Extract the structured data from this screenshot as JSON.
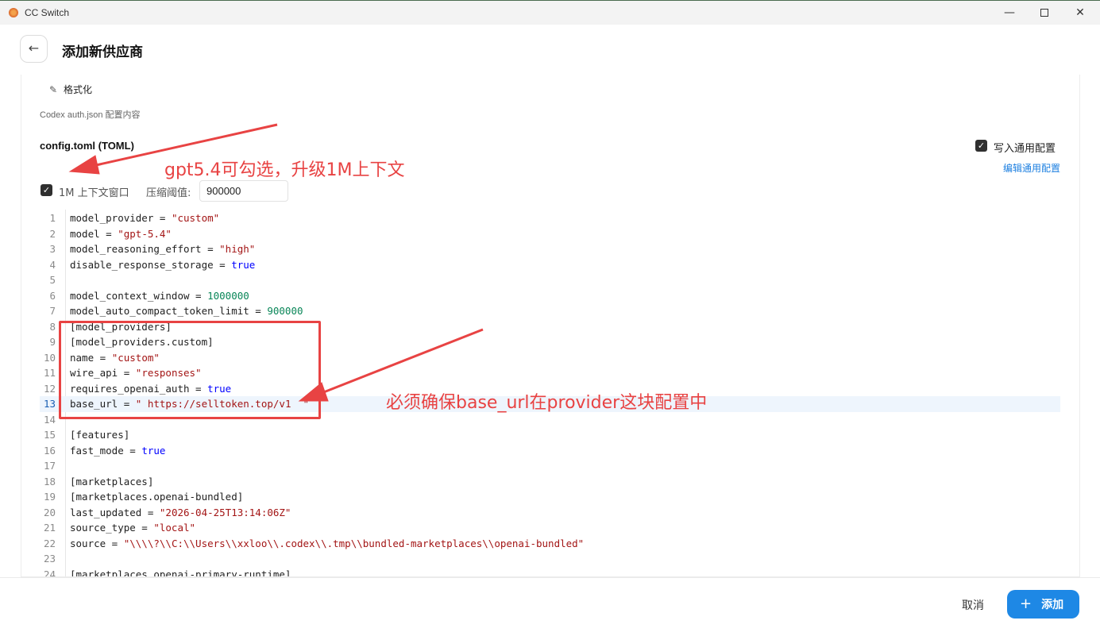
{
  "window": {
    "title": "CC Switch",
    "minimize": "—",
    "close": "✕"
  },
  "header": {
    "back_icon": "←",
    "title": "添加新供应商"
  },
  "toolbar": {
    "format_icon": "✎",
    "format_label": "格式化"
  },
  "auth": {
    "label": "Codex auth.json 配置内容"
  },
  "config": {
    "title": "config.toml (TOML)",
    "write_common_label": "写入通用配置",
    "write_common_checked": true,
    "edit_common_link": "编辑通用配置",
    "context_1m_label": "1M 上下文窗口",
    "context_1m_checked": true,
    "threshold_label": "压缩阈值:",
    "threshold_value": "900000"
  },
  "editor": {
    "active_line": 13,
    "lines": [
      {
        "n": "1",
        "text": "model_provider = \"custom\""
      },
      {
        "n": "2",
        "text": "model = \"gpt-5.4\""
      },
      {
        "n": "3",
        "text": "model_reasoning_effort = \"high\""
      },
      {
        "n": "4",
        "text": "disable_response_storage = true"
      },
      {
        "n": "5",
        "text": ""
      },
      {
        "n": "6",
        "text": "model_context_window = 1000000"
      },
      {
        "n": "7",
        "text": "model_auto_compact_token_limit = 900000"
      },
      {
        "n": "8",
        "text": "[model_providers]"
      },
      {
        "n": "9",
        "text": "[model_providers.custom]"
      },
      {
        "n": "10",
        "text": "name = \"custom\""
      },
      {
        "n": "11",
        "text": "wire_api = \"responses\""
      },
      {
        "n": "12",
        "text": "requires_openai_auth = true"
      },
      {
        "n": "13",
        "text": "base_url = \" https://selltoken.top/v1  \""
      },
      {
        "n": "14",
        "text": ""
      },
      {
        "n": "15",
        "text": "[features]"
      },
      {
        "n": "16",
        "text": "fast_mode = true"
      },
      {
        "n": "17",
        "text": ""
      },
      {
        "n": "18",
        "text": "[marketplaces]"
      },
      {
        "n": "19",
        "text": "[marketplaces.openai-bundled]"
      },
      {
        "n": "20",
        "text": "last_updated = \"2026-04-25T13:14:06Z\""
      },
      {
        "n": "21",
        "text": "source_type = \"local\""
      },
      {
        "n": "22",
        "text": "source = \"\\\\\\\\?\\\\C:\\\\Users\\\\xxloo\\\\.codex\\\\.tmp\\\\bundled-marketplaces\\\\openai-bundled\""
      },
      {
        "n": "23",
        "text": ""
      },
      {
        "n": "24",
        "text": "[marketplaces.openai-primary-runtime]"
      }
    ]
  },
  "footer": {
    "cancel_label": "取消",
    "add_icon": "+",
    "add_label": "添加"
  },
  "annotations": {
    "note_1m": "gpt5.4可勾选，升级1M上下文",
    "note_base_url": "必须确保base_url在provider这块配置中",
    "color": "#e84343"
  },
  "colors": {
    "accent": "#1e88e5",
    "link": "#1c7fe0",
    "string": "#a31515",
    "number": "#098658",
    "keyword": "#0000ff"
  }
}
